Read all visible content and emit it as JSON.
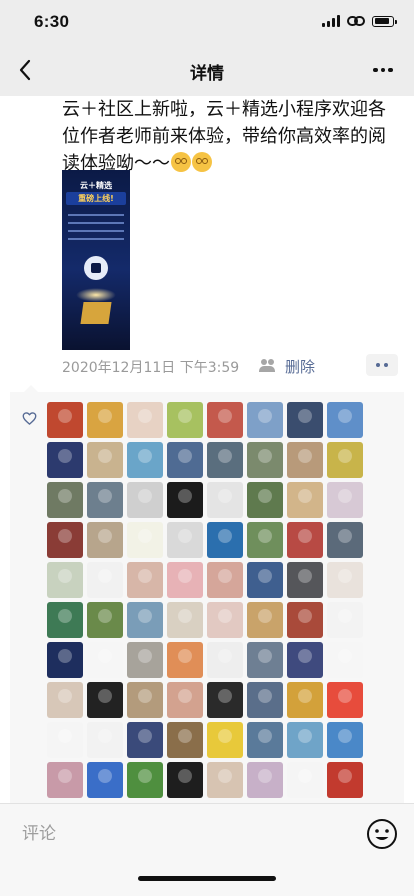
{
  "status_bar": {
    "time": "6:30"
  },
  "nav": {
    "title": "详情"
  },
  "post": {
    "text": "云＋社区上新啦，云＋精选小程序欢迎各位作者老师前来体验，带给你高效率的阅读体验呦～～",
    "date": "2020年12月11日 下午3:59",
    "delete_label": "删除",
    "poster": {
      "title": "云＋精选",
      "subtitle": "重磅上线!"
    }
  },
  "comment": {
    "placeholder": "评论"
  },
  "likes": {
    "avatars": [
      "#c0482f",
      "#d9a441",
      "#e7d2c4",
      "#a7c160",
      "#c4594c",
      "#7ea0c8",
      "#3a4d6e",
      "#5f8fc9",
      "#2c3a6e",
      "#c9b38f",
      "#6aa5c9",
      "#4f6b93",
      "#5a6e7e",
      "#7b8a6d",
      "#b89a7a",
      "#c8b44a",
      "#6f7a63",
      "#6d7f8e",
      "#cfcfcf",
      "#1b1b1b",
      "#e4e4e4",
      "#5f7a4e",
      "#d2b58a",
      "#d7c9d5",
      "#8a3c36",
      "#b7a58c",
      "#f2f2e6",
      "#d9d9d9",
      "#2b6fae",
      "#6f8f5c",
      "#b84a44",
      "#5b6a7a",
      "#c8d2bf",
      "#f1f1f1",
      "#d7b6a8",
      "#e7b2b6",
      "#d5a69a",
      "#3f5f8f",
      "#55565a",
      "#e9e2dc",
      "#3e7a55",
      "#6a8a4a",
      "#7a9db8",
      "#d9d0c2",
      "#e2c9c2",
      "#c9a36a",
      "#a94a3a",
      "#f3f3f3",
      "#1e2e5e",
      "#f6f6f6",
      "#a7a39b",
      "#e08e57",
      "#eeeeee",
      "#6e7f93",
      "#3f4a7e",
      "#f6f6f6",
      "#d7c7b8",
      "#222222",
      "#b39b7c",
      "#d3a28f",
      "#2a2a2a",
      "#5a6e8a",
      "#d3a13a",
      "#e74c3c",
      "#f5f5f5",
      "#f2f2f2",
      "#3a4a7a",
      "#8a6e4a",
      "#e8c93a",
      "#5a7a9a",
      "#6fa4c8",
      "#4a88c8",
      "#c89aa8",
      "#3a6ec8",
      "#4f8f3f",
      "#1e1e1e",
      "#d7c4b2",
      "#c7b0c8",
      "#f5f5f5",
      "#c23a2e"
    ]
  }
}
